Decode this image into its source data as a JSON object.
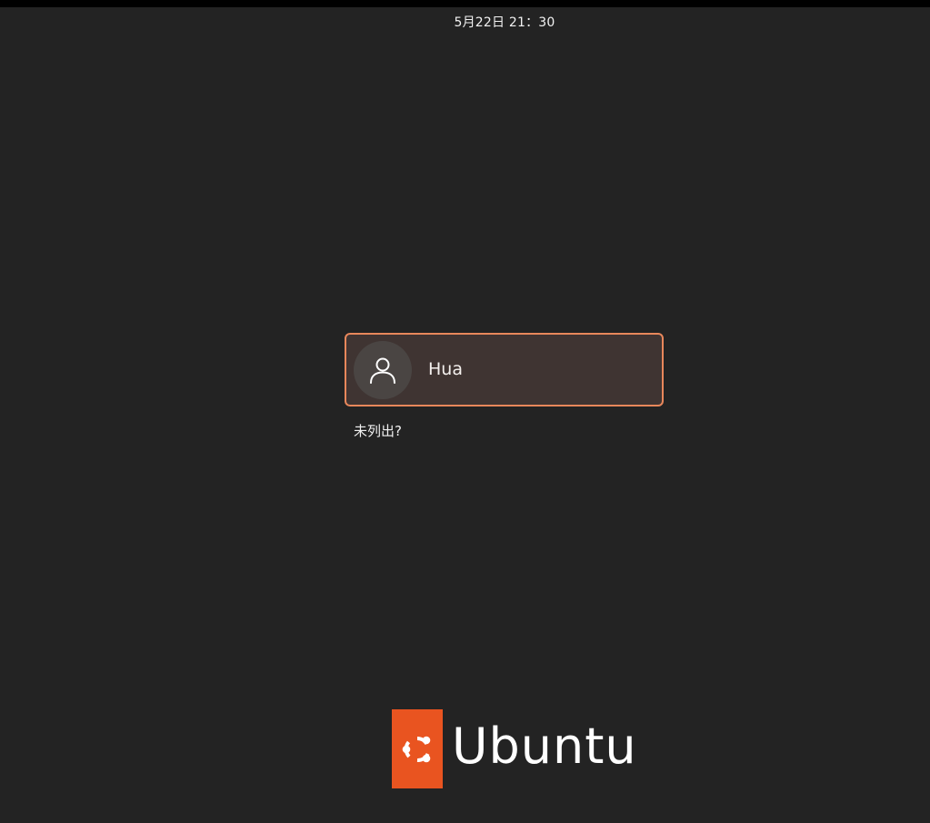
{
  "top_bar": {
    "datetime": "5月22日 21：30"
  },
  "login": {
    "users": [
      {
        "name": "Hua",
        "avatar_icon": "user-icon"
      }
    ],
    "not_listed_label": "未列出?",
    "accent_color": "#e8875b"
  },
  "branding": {
    "logo_icon": "ubuntu-circle-of-friends-icon",
    "wordmark": "Ubuntu",
    "brand_color": "#e95420"
  }
}
